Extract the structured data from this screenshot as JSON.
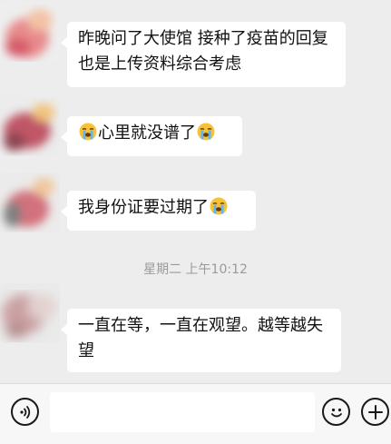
{
  "messages": [
    {
      "text": "昨晚问了大使馆 接种了疫苗的回复也是上传资料综合考虑"
    },
    {
      "pre_emoji": "crying-emoji",
      "text": "心里就没谱了",
      "post_emoji": "crying-emoji"
    },
    {
      "text": "我身份证要过期了",
      "post_emoji": "crying-emoji"
    }
  ],
  "timestamp": "星期二 上午10:12",
  "latest_message": {
    "text": "一直在等，一直在观望。越等越失望"
  },
  "input_bar": {
    "voice_icon": "voice-icon",
    "emoji_icon": "emoji-icon",
    "add_icon": "add-icon",
    "input_value": ""
  },
  "colors": {
    "background": "#ededed",
    "bubble": "#ffffff",
    "timestamp_text": "#9a9a9a",
    "icon_stroke": "#191919"
  }
}
